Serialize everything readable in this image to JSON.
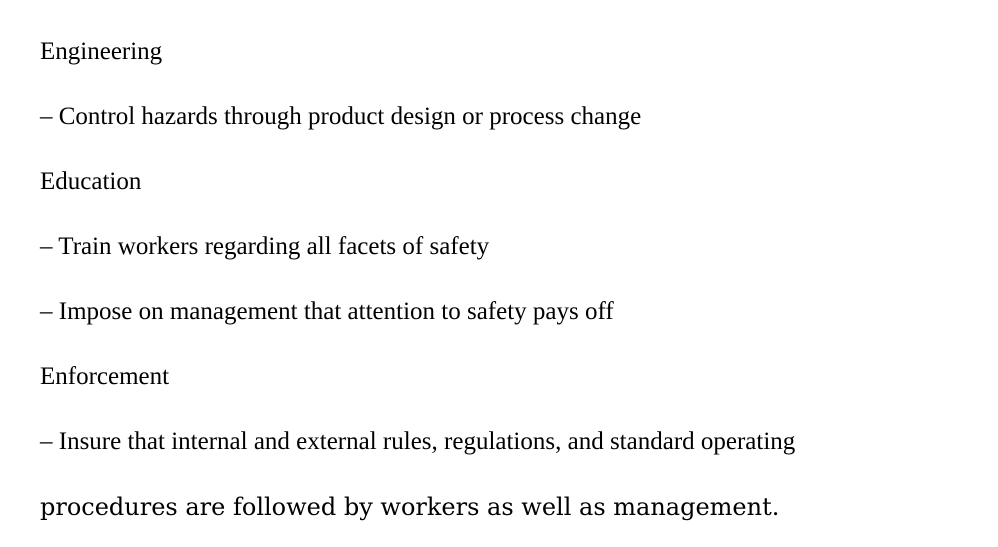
{
  "document": {
    "heading_engineering": "Engineering",
    "bullet_engineering_1": "– Control hazards through product design or process change",
    "heading_education": "Education",
    "bullet_education_1": "– Train workers regarding all facets of safety",
    "bullet_education_2": "– Impose on management that attention to safety pays off",
    "heading_enforcement": "Enforcement",
    "bullet_enforcement_1_line1": "– Insure that internal and external rules, regulations, and standard operating",
    "bullet_enforcement_1_line2": "procedures are followed by workers as well as management."
  }
}
